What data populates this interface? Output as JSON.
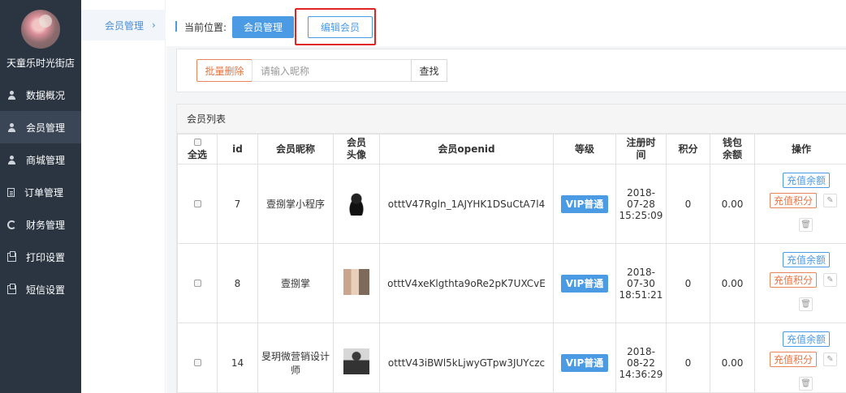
{
  "sidebar": {
    "shop_name": "天童乐时光街店",
    "items": [
      {
        "label": "数据概况",
        "icon": "person-icon"
      },
      {
        "label": "会员管理",
        "icon": "person-icon",
        "active": true
      },
      {
        "label": "商城管理",
        "icon": "person-icon"
      },
      {
        "label": "订单管理",
        "icon": "document-icon"
      },
      {
        "label": "财务管理",
        "icon": "recycle-icon"
      },
      {
        "label": "打印设置",
        "icon": "printer-icon"
      },
      {
        "label": "短信设置",
        "icon": "printer-icon"
      }
    ]
  },
  "subnav": {
    "label": "会员管理",
    "chevron": "›"
  },
  "breadcrumb": {
    "label": "当前位置:",
    "primary": "会员管理",
    "current": "编辑会员"
  },
  "search": {
    "bulk_delete": "批量删除",
    "placeholder": "请输入昵称",
    "button": "查找"
  },
  "list": {
    "title": "会员列表",
    "columns": {
      "select": "全选",
      "id": "id",
      "nickname": "会员昵称",
      "avatar_l1": "会员",
      "avatar_l2": "头像",
      "openid": "会员openid",
      "level": "等级",
      "reg_l1": "注册时",
      "reg_l2": "间",
      "points": "积分",
      "wallet_l1": "钱包",
      "wallet_l2": "余额",
      "ops": "操作"
    },
    "rows": [
      {
        "id": "7",
        "nickname": "壹捌掌小程序",
        "openid": "otttV47Rgln_1AJYHK1DSuCtA7l4",
        "level": "VIP普通",
        "reg_date": "2018-",
        "reg_md": "07-28",
        "reg_time": "15:25:09",
        "points": "0",
        "wallet": "0.00"
      },
      {
        "id": "8",
        "nickname": "壹捌掌",
        "openid": "otttV4xeKlgthta9oRe2pK7UXCvE",
        "level": "VIP普通",
        "reg_date": "2018-",
        "reg_md": "07-30",
        "reg_time": "18:51:21",
        "points": "0",
        "wallet": "0.00"
      },
      {
        "id": "14",
        "nickname": "旻玥微营销设计师",
        "openid": "otttV43iBWl5kLjwyGTpw3JUYczc",
        "level": "VIP普通",
        "reg_date": "2018-",
        "reg_md": "08-22",
        "reg_time": "14:36:29",
        "points": "0",
        "wallet": "0.00"
      }
    ],
    "ops": {
      "recharge_balance": "充值余额",
      "recharge_points": "充值积分"
    }
  }
}
